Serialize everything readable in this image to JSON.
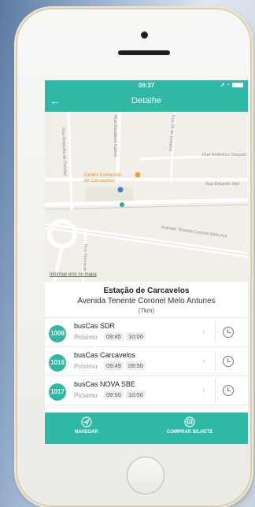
{
  "status": {
    "time": "09:37"
  },
  "header": {
    "title": "Detalhe",
    "back_label": "←"
  },
  "map": {
    "streets": [
      "Rua Marquês de Pombal",
      "Rua Sacadura Cabral",
      "Rua 28 de Outubro",
      "Rua Heliodoro Salgado",
      "Rua Eduardo Mal",
      "Avenida Tenente Coronel Melo Ant",
      "Rua Almirante"
    ],
    "poi_name": "Centro Comercial\nde Carcavelos",
    "credit": "Informar erro no mapa"
  },
  "station": {
    "name": "Estação de Carcavelos",
    "address": "Avenida Tenente Coronel Melo Antunes",
    "distance": "(7km)"
  },
  "next_label": "Próximo",
  "routes": [
    {
      "number": "1009",
      "name": "busCas SDR",
      "times": [
        "09:45",
        "10:00"
      ]
    },
    {
      "number": "1016",
      "name": "busCas Carcavelos",
      "times": [
        "09:49",
        "09:50"
      ]
    },
    {
      "number": "1017",
      "name": "busCas NOVA SBE",
      "times": [
        "09:50",
        "10:00"
      ]
    }
  ],
  "bottom": {
    "navigate": "NAVEGAR",
    "buy_ticket": "COMPRAR BILHETE"
  },
  "colors": {
    "accent": "#2fb8a5",
    "map_bg": "#f2efe8",
    "poi": "#e08e2b"
  }
}
